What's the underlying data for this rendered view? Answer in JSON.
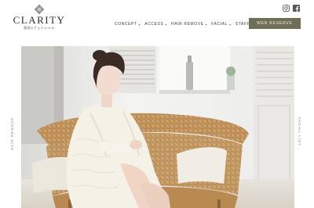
{
  "brand": {
    "name": "CLARITY",
    "subtitle": "脱毛&フェイシャル"
  },
  "nav": {
    "items": [
      {
        "label": "CONCEPT"
      },
      {
        "label": "ACCESS"
      },
      {
        "label": "HAIR REMOVE"
      },
      {
        "label": "FACIAL"
      },
      {
        "label": "STAFF"
      }
    ]
  },
  "reserve_button": {
    "label": "WEB RESERVE"
  },
  "social": {
    "icons": [
      "instagram-icon",
      "facebook-icon"
    ]
  },
  "side_labels": {
    "left": "HAIR REMOVE",
    "right": "FACIAL LIST"
  },
  "colors": {
    "accent": "#6e6f56",
    "background": "#ffffff"
  }
}
